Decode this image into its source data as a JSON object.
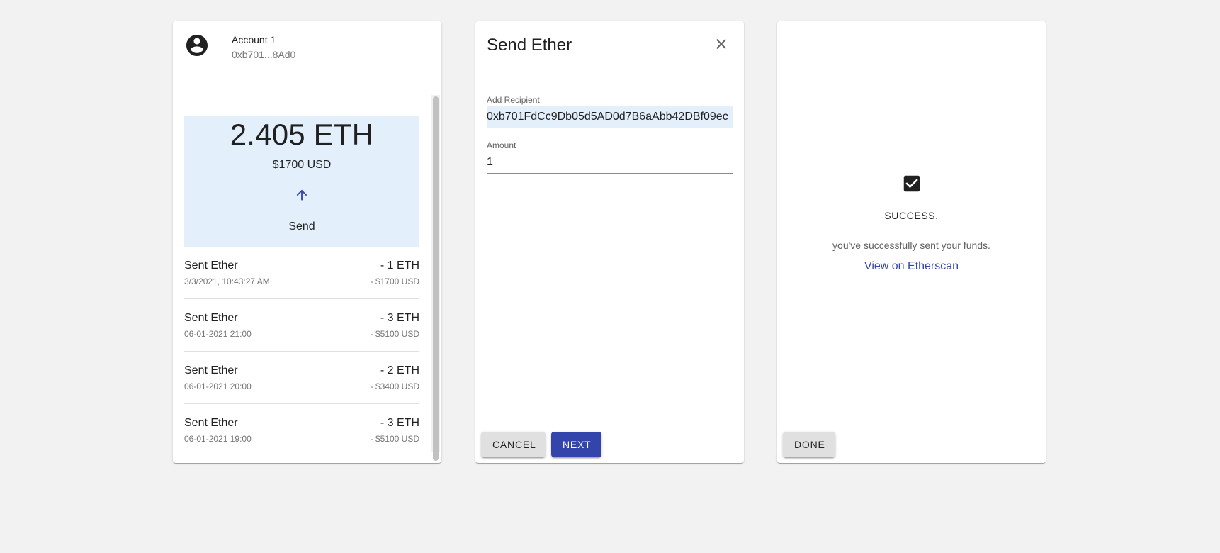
{
  "wallet": {
    "account_name": "Account 1",
    "account_address": "0xb701...8Ad0",
    "balance_eth": "2.405 ETH",
    "balance_usd": "$1700 USD",
    "send_label": "Send",
    "transactions": [
      {
        "title": "Sent Ether",
        "date": "3/3/2021, 10:43:27 AM",
        "amount_eth": "- 1 ETH",
        "amount_usd": "- $1700 USD"
      },
      {
        "title": "Sent Ether",
        "date": "06-01-2021 21:00",
        "amount_eth": "- 3 ETH",
        "amount_usd": "- $5100 USD"
      },
      {
        "title": "Sent Ether",
        "date": "06-01-2021 20:00",
        "amount_eth": "- 2 ETH",
        "amount_usd": "- $3400 USD"
      },
      {
        "title": "Sent Ether",
        "date": "06-01-2021 19:00",
        "amount_eth": "- 3 ETH",
        "amount_usd": "- $5100 USD"
      }
    ]
  },
  "send_form": {
    "title": "Send Ether",
    "recipient_label": "Add Recipient",
    "recipient_value": "0xb701FdCc9Db05d5AD0d7B6aAbb42DBf09ec",
    "amount_label": "Amount",
    "amount_value": "1",
    "cancel_label": "CANCEL",
    "next_label": "NEXT"
  },
  "success": {
    "title": "SUCCESS.",
    "message": "you've successfully sent your funds.",
    "link_label": "View on Etherscan",
    "done_label": "DONE"
  },
  "icons": {
    "avatar": "account-circle-icon",
    "send": "arrow-up-icon",
    "close": "close-icon",
    "check": "checkbox-checked-icon"
  },
  "colors": {
    "background": "#f2f2f2",
    "accent": "#3344aa",
    "highlight": "#e3f0fc"
  }
}
